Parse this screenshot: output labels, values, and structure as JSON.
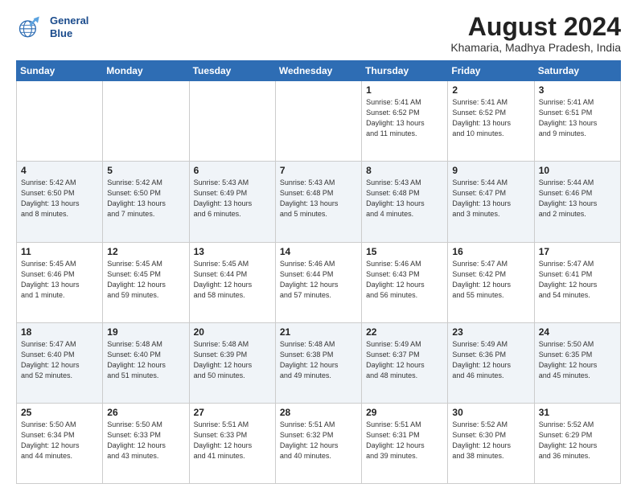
{
  "header": {
    "logo_line1": "General",
    "logo_line2": "Blue",
    "title": "August 2024",
    "subtitle": "Khamaria, Madhya Pradesh, India"
  },
  "days_of_week": [
    "Sunday",
    "Monday",
    "Tuesday",
    "Wednesday",
    "Thursday",
    "Friday",
    "Saturday"
  ],
  "weeks": [
    [
      {
        "day": "",
        "info": ""
      },
      {
        "day": "",
        "info": ""
      },
      {
        "day": "",
        "info": ""
      },
      {
        "day": "",
        "info": ""
      },
      {
        "day": "1",
        "info": "Sunrise: 5:41 AM\nSunset: 6:52 PM\nDaylight: 13 hours\nand 11 minutes."
      },
      {
        "day": "2",
        "info": "Sunrise: 5:41 AM\nSunset: 6:52 PM\nDaylight: 13 hours\nand 10 minutes."
      },
      {
        "day": "3",
        "info": "Sunrise: 5:41 AM\nSunset: 6:51 PM\nDaylight: 13 hours\nand 9 minutes."
      }
    ],
    [
      {
        "day": "4",
        "info": "Sunrise: 5:42 AM\nSunset: 6:50 PM\nDaylight: 13 hours\nand 8 minutes."
      },
      {
        "day": "5",
        "info": "Sunrise: 5:42 AM\nSunset: 6:50 PM\nDaylight: 13 hours\nand 7 minutes."
      },
      {
        "day": "6",
        "info": "Sunrise: 5:43 AM\nSunset: 6:49 PM\nDaylight: 13 hours\nand 6 minutes."
      },
      {
        "day": "7",
        "info": "Sunrise: 5:43 AM\nSunset: 6:48 PM\nDaylight: 13 hours\nand 5 minutes."
      },
      {
        "day": "8",
        "info": "Sunrise: 5:43 AM\nSunset: 6:48 PM\nDaylight: 13 hours\nand 4 minutes."
      },
      {
        "day": "9",
        "info": "Sunrise: 5:44 AM\nSunset: 6:47 PM\nDaylight: 13 hours\nand 3 minutes."
      },
      {
        "day": "10",
        "info": "Sunrise: 5:44 AM\nSunset: 6:46 PM\nDaylight: 13 hours\nand 2 minutes."
      }
    ],
    [
      {
        "day": "11",
        "info": "Sunrise: 5:45 AM\nSunset: 6:46 PM\nDaylight: 13 hours\nand 1 minute."
      },
      {
        "day": "12",
        "info": "Sunrise: 5:45 AM\nSunset: 6:45 PM\nDaylight: 12 hours\nand 59 minutes."
      },
      {
        "day": "13",
        "info": "Sunrise: 5:45 AM\nSunset: 6:44 PM\nDaylight: 12 hours\nand 58 minutes."
      },
      {
        "day": "14",
        "info": "Sunrise: 5:46 AM\nSunset: 6:44 PM\nDaylight: 12 hours\nand 57 minutes."
      },
      {
        "day": "15",
        "info": "Sunrise: 5:46 AM\nSunset: 6:43 PM\nDaylight: 12 hours\nand 56 minutes."
      },
      {
        "day": "16",
        "info": "Sunrise: 5:47 AM\nSunset: 6:42 PM\nDaylight: 12 hours\nand 55 minutes."
      },
      {
        "day": "17",
        "info": "Sunrise: 5:47 AM\nSunset: 6:41 PM\nDaylight: 12 hours\nand 54 minutes."
      }
    ],
    [
      {
        "day": "18",
        "info": "Sunrise: 5:47 AM\nSunset: 6:40 PM\nDaylight: 12 hours\nand 52 minutes."
      },
      {
        "day": "19",
        "info": "Sunrise: 5:48 AM\nSunset: 6:40 PM\nDaylight: 12 hours\nand 51 minutes."
      },
      {
        "day": "20",
        "info": "Sunrise: 5:48 AM\nSunset: 6:39 PM\nDaylight: 12 hours\nand 50 minutes."
      },
      {
        "day": "21",
        "info": "Sunrise: 5:48 AM\nSunset: 6:38 PM\nDaylight: 12 hours\nand 49 minutes."
      },
      {
        "day": "22",
        "info": "Sunrise: 5:49 AM\nSunset: 6:37 PM\nDaylight: 12 hours\nand 48 minutes."
      },
      {
        "day": "23",
        "info": "Sunrise: 5:49 AM\nSunset: 6:36 PM\nDaylight: 12 hours\nand 46 minutes."
      },
      {
        "day": "24",
        "info": "Sunrise: 5:50 AM\nSunset: 6:35 PM\nDaylight: 12 hours\nand 45 minutes."
      }
    ],
    [
      {
        "day": "25",
        "info": "Sunrise: 5:50 AM\nSunset: 6:34 PM\nDaylight: 12 hours\nand 44 minutes."
      },
      {
        "day": "26",
        "info": "Sunrise: 5:50 AM\nSunset: 6:33 PM\nDaylight: 12 hours\nand 43 minutes."
      },
      {
        "day": "27",
        "info": "Sunrise: 5:51 AM\nSunset: 6:33 PM\nDaylight: 12 hours\nand 41 minutes."
      },
      {
        "day": "28",
        "info": "Sunrise: 5:51 AM\nSunset: 6:32 PM\nDaylight: 12 hours\nand 40 minutes."
      },
      {
        "day": "29",
        "info": "Sunrise: 5:51 AM\nSunset: 6:31 PM\nDaylight: 12 hours\nand 39 minutes."
      },
      {
        "day": "30",
        "info": "Sunrise: 5:52 AM\nSunset: 6:30 PM\nDaylight: 12 hours\nand 38 minutes."
      },
      {
        "day": "31",
        "info": "Sunrise: 5:52 AM\nSunset: 6:29 PM\nDaylight: 12 hours\nand 36 minutes."
      }
    ]
  ]
}
